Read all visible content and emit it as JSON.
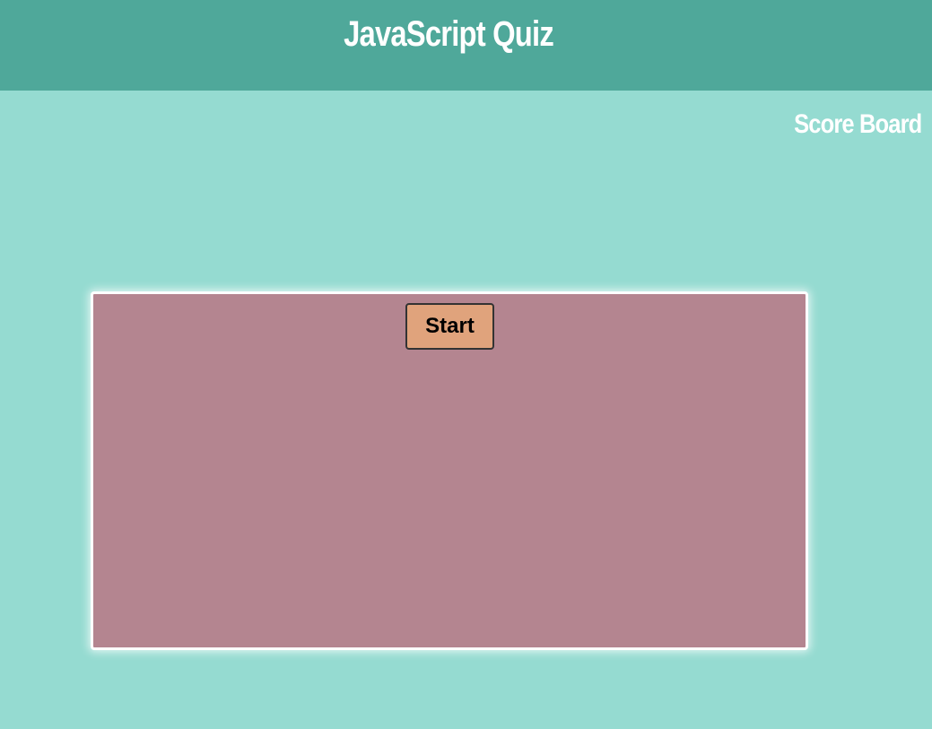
{
  "header": {
    "title": "JavaScript Quiz"
  },
  "nav": {
    "scoreboard_label": "Score Board"
  },
  "quiz": {
    "start_label": "Start"
  },
  "colors": {
    "header_bg": "#4fa89a",
    "page_bg": "#95dbd1",
    "quiz_box_bg": "#b48590",
    "start_button_bg": "#e0a37c",
    "text_light": "#ffffff"
  }
}
